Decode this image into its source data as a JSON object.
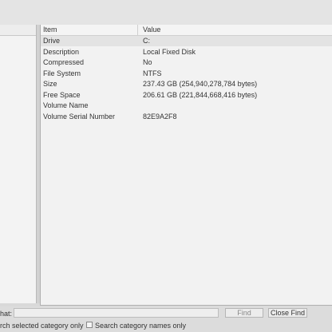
{
  "table": {
    "headers": {
      "item": "Item",
      "value": "Value"
    },
    "rows": [
      {
        "item": "Drive",
        "value": "C:"
      },
      {
        "item": "Description",
        "value": "Local Fixed Disk"
      },
      {
        "item": "Compressed",
        "value": "No"
      },
      {
        "item": "File System",
        "value": "NTFS"
      },
      {
        "item": "Size",
        "value": "237.43 GB (254,940,278,784 bytes)"
      },
      {
        "item": "Free Space",
        "value": "206.61 GB (221,844,668,416 bytes)"
      },
      {
        "item": "Volume Name",
        "value": ""
      },
      {
        "item": "Volume Serial Number",
        "value": "82E9A2F8"
      }
    ]
  },
  "find_bar": {
    "label": "hat:",
    "input_value": "",
    "find_button": "Find",
    "close_find_button": "Close Find",
    "search_selected_label": "rch selected category only",
    "search_names_label": "Search category names only"
  }
}
